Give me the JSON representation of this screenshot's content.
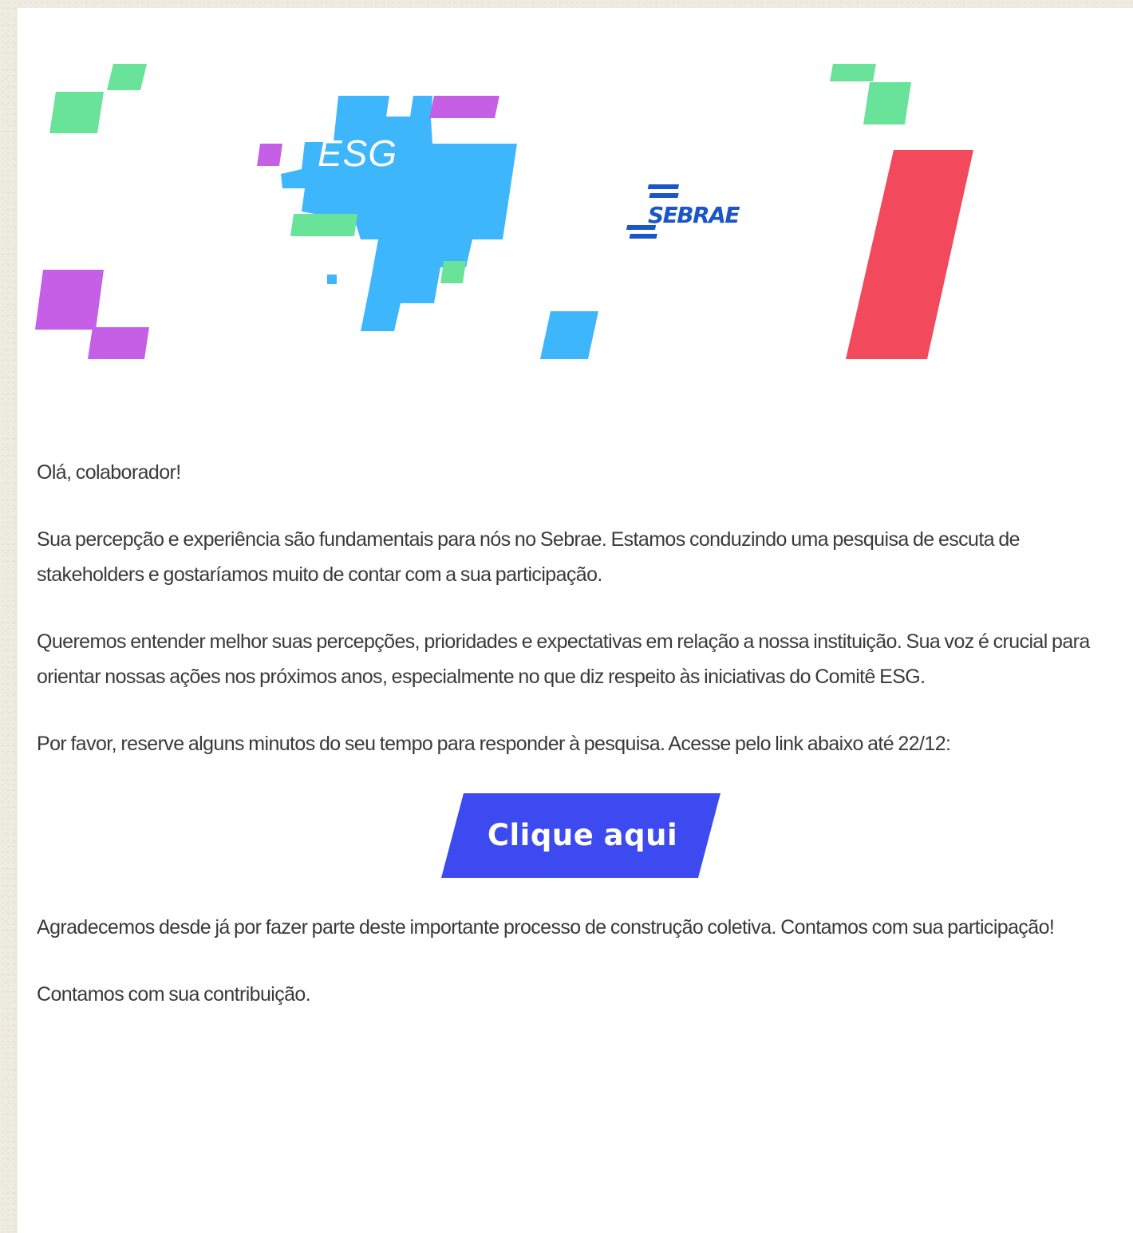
{
  "banner": {
    "esg_label": "ESG",
    "logo_text": "SEBRAE",
    "colors": {
      "green": "#6ae39a",
      "purple": "#c45fe6",
      "blue": "#3eb6fb",
      "red": "#f24a5c",
      "logo_blue": "#1a56c7"
    }
  },
  "email": {
    "greeting": "Olá, colaborador!",
    "paragraph_1": "Sua percepção e experiência são fundamentais para nós no Sebrae. Estamos conduzindo uma pesquisa de escuta de stakeholders e gostaríamos muito de contar com a sua participação.",
    "paragraph_2": "Queremos entender melhor suas percepções, prioridades e expectativas em relação a nossa instituição. Sua voz é crucial para orientar nossas ações nos próximos anos, especialmente no que diz respeito às iniciativas do Comitê ESG.",
    "paragraph_3": "Por favor, reserve alguns minutos do seu tempo para responder à pesquisa. Acesse pelo link abaixo até 22/12:",
    "cta_label": "Clique aqui",
    "cta_color": "#3d4af0",
    "paragraph_4": "Agradecemos desde já por fazer parte deste importante processo de construção coletiva. Contamos com sua participação!",
    "closing": "Contamos com sua contribuição."
  }
}
